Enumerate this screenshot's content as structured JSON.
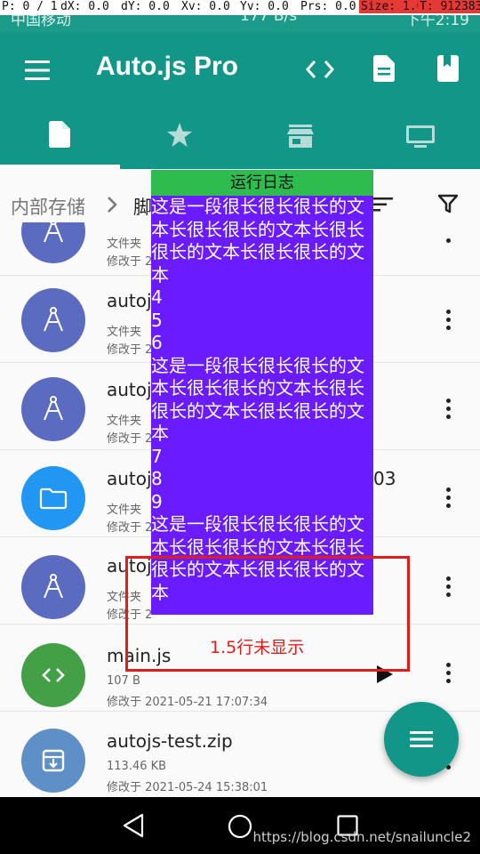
{
  "status_bar": {
    "carrier": "中国移动",
    "speed": "177 B/s",
    "time": "下午2:19"
  },
  "debug_bar": {
    "p": "P: 0 / 1",
    "dx": "dX: 0.0",
    "dy": "dY: 0.0",
    "xv": "Xv: 0.0",
    "yv": "Yv: 0.0",
    "prs": "Prs: 0.0",
    "size": "Size: 1.0",
    "t": "T: 912383"
  },
  "app_bar": {
    "title": "Auto.js Pro",
    "icons": [
      "menu-icon",
      "code-icon",
      "document-icon",
      "bookmark-icon"
    ],
    "tabs": [
      "file-icon",
      "star-icon",
      "store-icon",
      "monitor-icon"
    ],
    "color": "#119688"
  },
  "breadcrumb": {
    "root": "内部存储",
    "next": "脚"
  },
  "files": [
    {
      "name": "",
      "type": "文件夹",
      "modified": "修改于 2",
      "icon": "compass-icon",
      "color": "#5b6bc0"
    },
    {
      "name": "autojs",
      "type": "文件夹",
      "modified": "修改于 2",
      "icon": "compass-icon",
      "color": "#5b6bc0"
    },
    {
      "name": "autoj",
      "type": "文件夹",
      "modified": "修改于 2",
      "icon": "compass-icon",
      "color": "#5b6bc0"
    },
    {
      "name": "autojs",
      "suffix": "03",
      "type": "文件夹",
      "modified": "修改于 2",
      "icon": "folder-icon",
      "color": "#2196f3"
    },
    {
      "name": "autoj",
      "type": "文件夹",
      "modified": "修改于 2",
      "icon": "compass-icon",
      "color": "#5b6bc0"
    },
    {
      "name": "main.js",
      "type": "107 B",
      "modified": "修改于 2021-05-21 17:07:34",
      "icon": "code-icon",
      "color": "#43a047"
    },
    {
      "name": "autojs-test.zip",
      "type": "113.46 KB",
      "modified": "修改于 2021-05-24 15:38:01",
      "icon": "archive-icon",
      "color": "#5e8fc6"
    }
  ],
  "log_window": {
    "title": "运行日志",
    "lines": [
      "这是一段很长很长很长的文本长很长很长的文本长很长很长的文本长很长很长的文本",
      "4",
      "5",
      "6",
      "这是一段很长很长很长的文本长很长很长的文本长很长很长的文本长很长很长的文本",
      "7",
      "8",
      "9",
      "这是一段很长很长很长的文本长很长很长的文本长很长很长的文本长很长很长的文本"
    ],
    "header_color": "#2ebc4f",
    "body_color": "#6a1bff"
  },
  "annotation": {
    "text": "1.5行未显示",
    "color": "#e31b1b"
  },
  "fab": {
    "icon": "list-icon"
  },
  "nav_bar": {
    "icons": [
      "back-icon",
      "home-icon",
      "recents-icon"
    ],
    "watermark": "https://blog.csdn.net/snailuncle2"
  }
}
